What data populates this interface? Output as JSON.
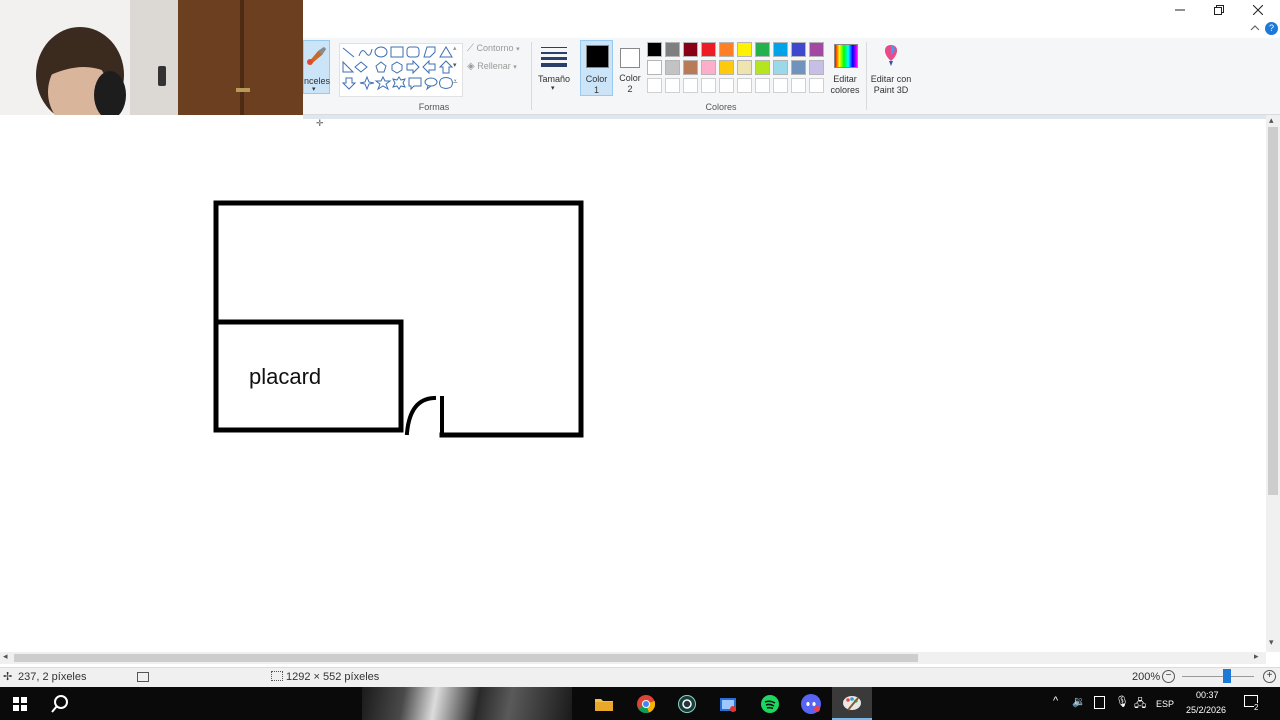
{
  "ribbon": {
    "brushes_label": "nceles",
    "shapes_group_label": "Formas",
    "outline_label": "Contorno",
    "fill_label": "Rellenar",
    "size_label": "Tamaño",
    "color1_label_line1": "Color",
    "color1_label_line2": "1",
    "color2_label_line1": "Color",
    "color2_label_line2": "2",
    "colors_group_label": "Colores",
    "edit_colors_line1": "Editar",
    "edit_colors_line2": "colores",
    "paint3d_line1": "Editar con",
    "paint3d_line2": "Paint 3D"
  },
  "palette": {
    "row1": [
      "#000000",
      "#7f7f7f",
      "#880015",
      "#ed1c24",
      "#ff7f27",
      "#fff200",
      "#22b14c",
      "#00a2e8",
      "#3f48cc",
      "#a349a4"
    ],
    "row2": [
      "#ffffff",
      "#c3c3c3",
      "#b97a57",
      "#ffaec9",
      "#ffc90e",
      "#efe4b0",
      "#b5e61d",
      "#99d9ea",
      "#7092be",
      "#c8bfe7"
    ],
    "color1": "#000000",
    "color2": "#ffffff"
  },
  "canvas": {
    "room_label": "placard",
    "stroke_color": "#000000"
  },
  "status": {
    "cursor_position": "237, 2 píxeles",
    "image_size": "1292 × 552 píxeles",
    "zoom": "200%",
    "zoom_level": 0.62
  },
  "taskbar": {
    "language": "ESP",
    "time": "00:37",
    "date": "25/2/2026",
    "notification_count": "2"
  },
  "accent": "#0078d7"
}
